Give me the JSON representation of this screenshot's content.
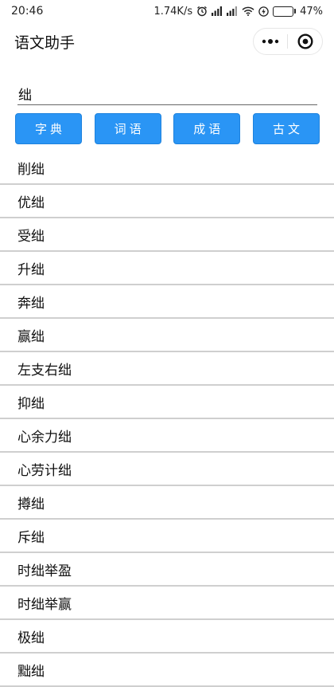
{
  "status_bar": {
    "time": "20:46",
    "network_speed": "1.74K/s",
    "battery_percent": "47%",
    "battery_level": 0.47,
    "icons": [
      "alarm-icon",
      "signal-icon",
      "signal-icon-2",
      "wifi-icon",
      "charging-icon",
      "battery-icon"
    ]
  },
  "nav": {
    "title": "语文助手",
    "capsule_icons": [
      "more-dots-icon",
      "close-circle-icon"
    ]
  },
  "search": {
    "value": "绌",
    "placeholder": ""
  },
  "buttons": [
    {
      "label": "字典"
    },
    {
      "label": "词语"
    },
    {
      "label": "成语"
    },
    {
      "label": "古文"
    }
  ],
  "results": [
    "削绌",
    "优绌",
    "受绌",
    "升绌",
    "奔绌",
    "赢绌",
    "左支右绌",
    "抑绌",
    "心余力绌",
    "心劳计绌",
    "撙绌",
    "斥绌",
    "时绌举盈",
    "时绌举赢",
    "极绌",
    "黜绌"
  ],
  "colors": {
    "button_blue": "#2a95f5",
    "divider": "#cfcfcf",
    "battery_green": "#4caf50"
  }
}
